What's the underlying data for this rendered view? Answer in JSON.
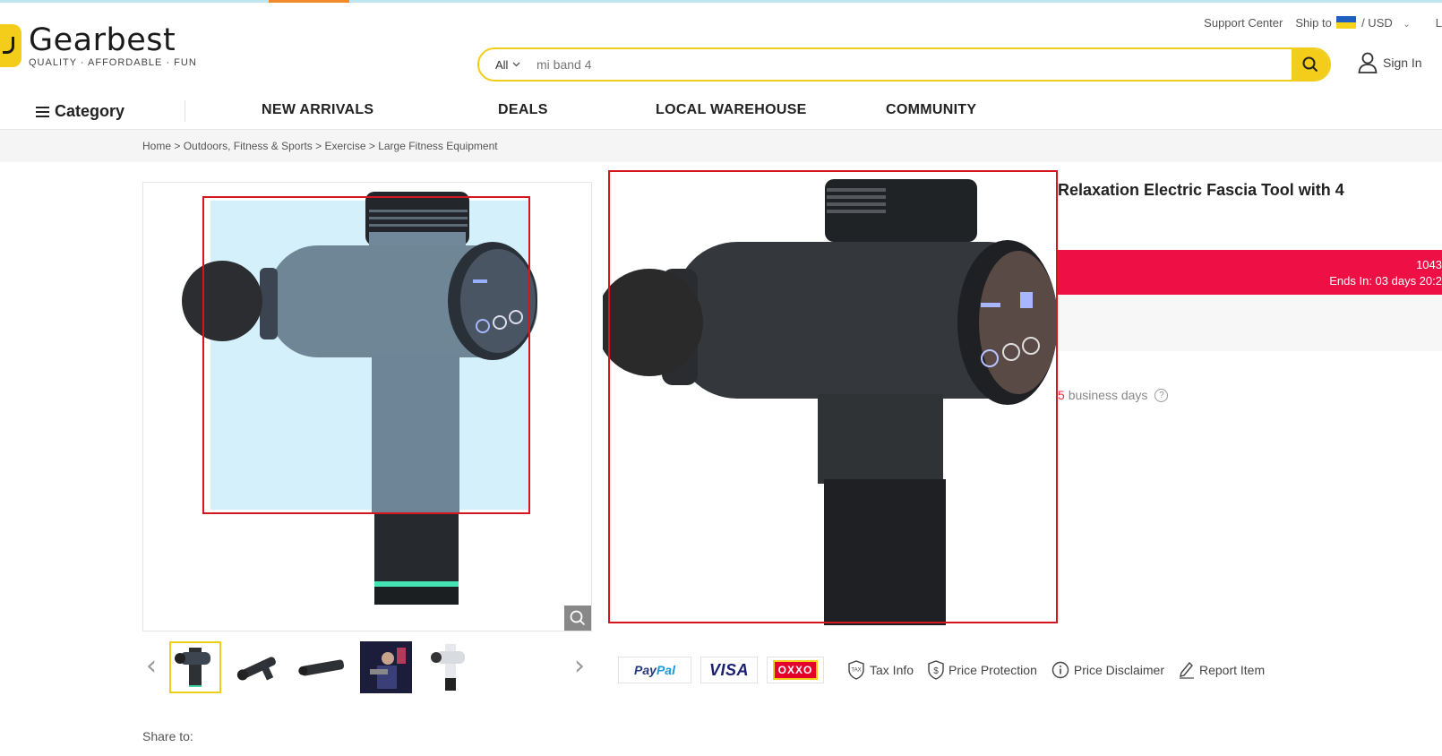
{
  "header": {
    "logo_name": "Gearbest",
    "logo_tagline": "QUALITY · AFFORDABLE · FUN",
    "support": "Support Center",
    "ship_to": "Ship to",
    "currency": "/ USD",
    "lang_partial": "L",
    "search_scope": "All",
    "search_value": "mi band 4",
    "sign_in": "Sign In"
  },
  "nav": {
    "category": "Category",
    "items": [
      "NEW ARRIVALS",
      "DEALS",
      "LOCAL WAREHOUSE",
      "COMMUNITY"
    ]
  },
  "breadcrumb": [
    "Home",
    "Outdoors, Fitness & Sports",
    "Exercise",
    "Large Fitness Equipment"
  ],
  "breadcrumb_sep": ">",
  "product": {
    "title": "Relaxation Electric Fascia Tool with 4",
    "flash_count": "1043",
    "flash_ends": "Ends In: 03 days 20:2",
    "shipping_num": "5",
    "shipping_text": "business days",
    "help": "?"
  },
  "payments": {
    "paypal_a": "Pay",
    "paypal_b": "Pal",
    "visa": "VISA",
    "oxxo": "OXXO"
  },
  "links": {
    "tax": "Tax Info",
    "protection": "Price Protection",
    "disclaimer": "Price Disclaimer",
    "report": "Report Item"
  },
  "share": "Share to:",
  "colors": {
    "brand_yellow": "#f4cc1a",
    "flash_red": "#ee0f44",
    "annotation_red": "#d6161e"
  }
}
